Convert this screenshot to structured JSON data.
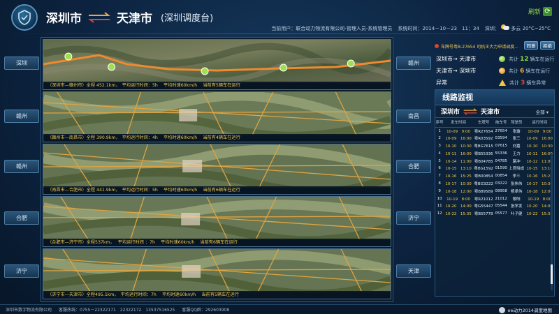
{
  "header": {
    "origin": "深圳市",
    "destination": "天津市",
    "subtitle": "(深圳调度台)",
    "refresh_label": "刷新",
    "user": "当前用户：联合动力物流有限公司-管理人员-系统管理员",
    "system_time": "系统时间：2014－10－23　11：34",
    "weather_city": "深圳：",
    "weather_desc": "多云",
    "temperature": "20°C~25°C"
  },
  "left_cities": [
    "深圳",
    "赣州",
    "赣州",
    "合肥",
    "济宁"
  ],
  "right_cities": [
    "赣州",
    "南昌",
    "合肥",
    "济宁",
    "天津"
  ],
  "map_rows": [
    {
      "caption": "（深圳市—赣州市）全程 452.1km，　平均运行时间：5h　 平均时速60km/h　 当前有5辆车在运行"
    },
    {
      "caption": "（赣州市—南昌市）全程 390.9km，　平均运行时间：4h　 平均时速60km/h　 当前有4辆车在运行"
    },
    {
      "caption": "（南昌市—合肥市）全程 441.9km，　平均运行时间：5h　 平均时速60km/h　 当前有6辆车在运行"
    },
    {
      "caption": "（合肥市—济宁市）全程537km，　 平均运行时间 ：7h　 平均时速60km/h　 当前有6辆车在运行"
    },
    {
      "caption": "（济宁市—天津市）全程495.1km，　平均运行时间：7h　 平均时速60km/h　 当前有5辆车在运行"
    }
  ],
  "notice": {
    "text": "车牌号粤B-27654 司机王大力申请调度...",
    "agree_label": "同意",
    "reject_label": "拒绝"
  },
  "summary": [
    {
      "label": "深圳市→ 天津市",
      "prefix": "共计",
      "count": "12",
      "suffix": "辆车在运行",
      "status": "green"
    },
    {
      "label": "天津市→ 深圳市",
      "prefix": "共计",
      "count": "6",
      "suffix": "辆车在运行",
      "status": "orange"
    },
    {
      "label": "异常",
      "prefix": "共计",
      "count": "3",
      "suffix": "辆车异常",
      "status": "red"
    }
  ],
  "monitor": {
    "title": "线路监视",
    "route_from": "深圳市",
    "route_to": "天津市",
    "filter_label": "全部 ▾",
    "columns": [
      "序号",
      "发车时间",
      "车牌号",
      "拖车号",
      "驾驶员",
      "运行时间"
    ],
    "rows": [
      [
        "1",
        "10-09　9:00",
        "粤R27654",
        "27654",
        "张露",
        "10-09　9:00"
      ],
      [
        "2",
        "10-09　16:00",
        "粤R03592",
        "03594",
        "张三",
        "10-09　16:00"
      ],
      [
        "3",
        "10-10　10:30",
        "粤BG7615",
        "07615",
        "刘嘉",
        "10-10　10:30"
      ],
      [
        "4",
        "10-11　16:00",
        "粤B55336",
        "55336",
        "王力",
        "10-11　16:00"
      ],
      [
        "5",
        "10-14　11:00",
        "粤B04785",
        "04785",
        "路冲",
        "10-12　11:00"
      ],
      [
        "6",
        "10-15　13:10",
        "粤BG1592",
        "01590",
        "上官晓成",
        "10-15　13:10"
      ],
      [
        "7",
        "10-16　15:25",
        "粤B00854",
        "00854",
        "李三",
        "10-16　15:25"
      ],
      [
        "8",
        "10-17　10:30",
        "粤BG3222",
        "03222",
        "张伟伟",
        "10-17　10:30"
      ],
      [
        "9",
        "10-18　12:00",
        "粤B89589",
        "08958",
        "杨承伟",
        "10-18　12:00"
      ],
      [
        "10",
        "10-19　8:00",
        "粤R21012",
        "21012",
        "黎阳",
        "10-19　8:00"
      ],
      [
        "11",
        "10-20　14:00",
        "粤G55447",
        "05544",
        "张学发",
        "10-20　14:00"
      ],
      [
        "12",
        "10-22　15:35",
        "粤B55778",
        "05577",
        "叶子健",
        "10-22　15:35"
      ]
    ]
  },
  "footer": {
    "company": "深圳市数字物流有限公司",
    "hotline": "客服热线：0755－22322171　22322172　13537516525",
    "qq": "客服QQ群：292603908",
    "brand": "ee动力2014调度地图"
  }
}
